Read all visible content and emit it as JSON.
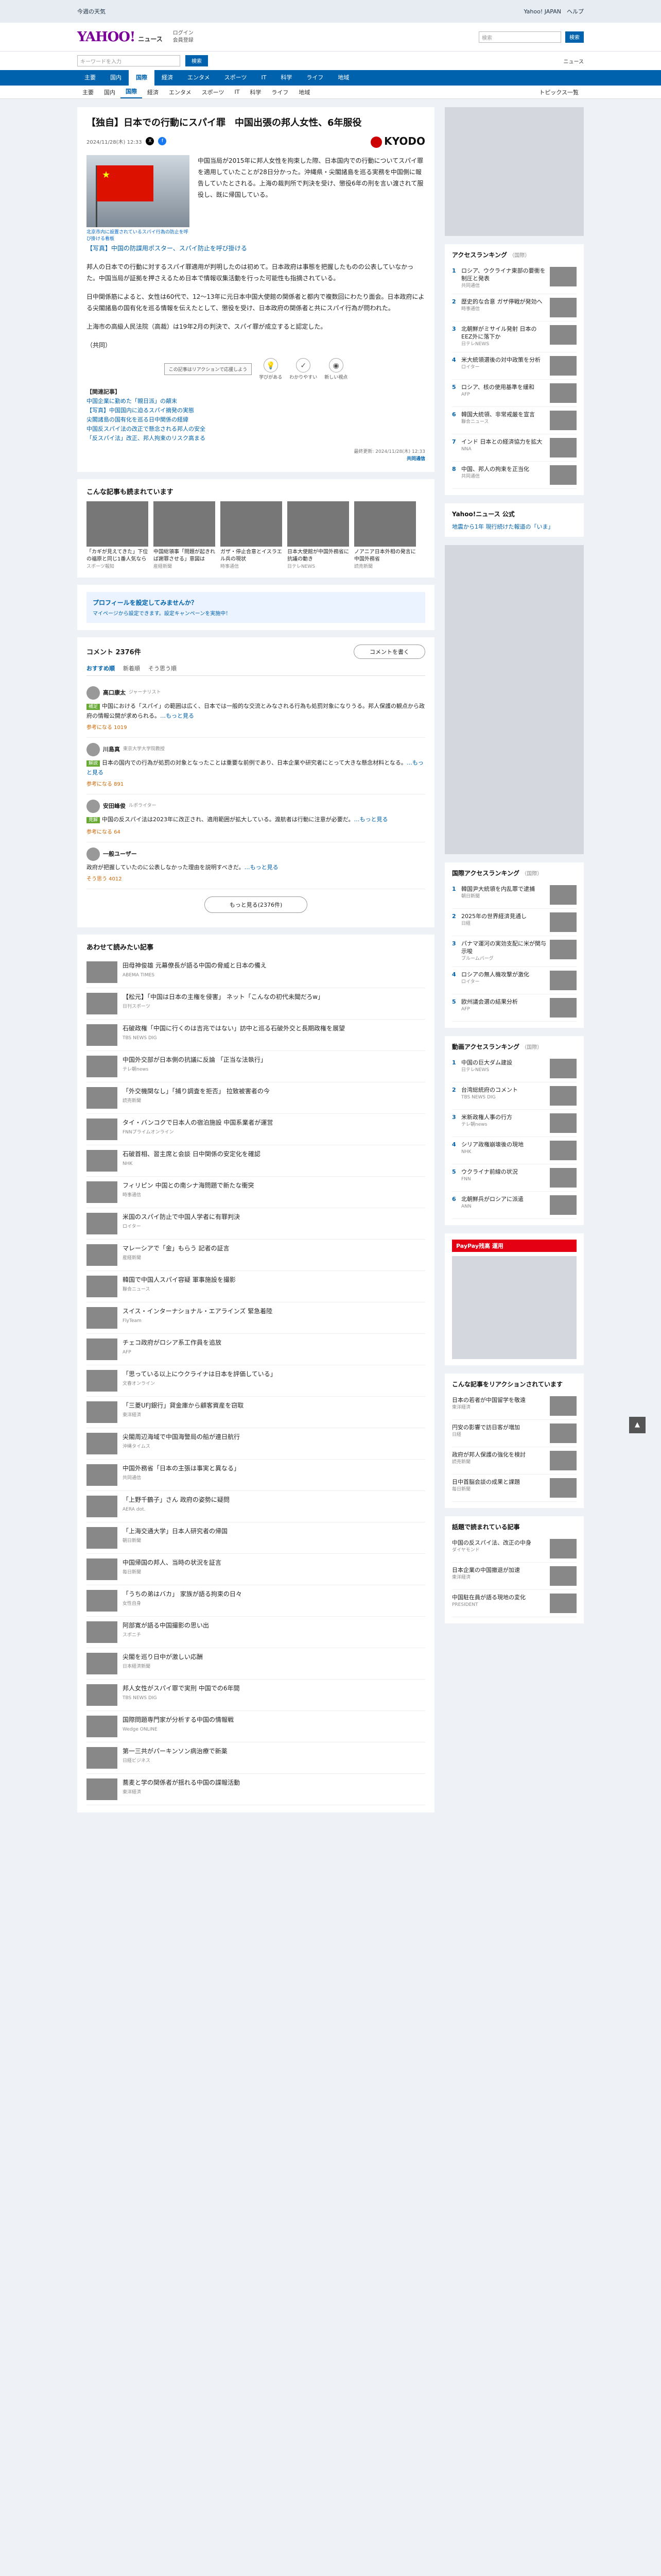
{
  "topbar": {
    "message": "今週の天気",
    "nav": "Yahoo! JAPAN　ヘルプ"
  },
  "header": {
    "logo": "YAHOO!",
    "logo_sub": "ニュース",
    "link1": "ログイン",
    "link2": "会員登録",
    "search_placeholder": "検索",
    "search_button": "検索"
  },
  "search": {
    "placeholder": "キーワードを入力",
    "button": "検索",
    "right": "ニュース"
  },
  "catnav": [
    "主要",
    "国内",
    "国際",
    "経済",
    "エンタメ",
    "スポーツ",
    "IT",
    "科学",
    "ライフ",
    "地域"
  ],
  "catnav_active": "国際",
  "subnav": [
    "主要",
    "国内",
    "国際",
    "経済",
    "エンタメ",
    "スポーツ",
    "IT",
    "科学",
    "ライフ",
    "地域"
  ],
  "subnav_more": "トピックス一覧",
  "article": {
    "title": "【独自】日本での行動にスパイ罪　中国出張の邦人女性、6年服役",
    "date": "2024/11/28(木) 12:33",
    "source": "KYODO",
    "photo_caption": "北京市内に設置されているスパイ行為の防止を呼び掛ける看板",
    "paragraphs": [
      "中国当局が2015年に邦人女性を拘束した際、日本国内での行動についてスパイ罪を適用していたことが28日分かった。沖縄県・尖閣諸島を巡る実務を中国側に報告していたとされる。上海の裁判所で判決を受け、懲役6年の刑を言い渡されて服役し、既に帰国している。",
      "邦人の日本での行動に対するスパイ罪適用が判明したのは初めて。日本政府は事態を把握したものの公表していなかった。中国当局が証拠を押さえるため日本で情報収集活動を行った可能性も指摘されている。",
      "日中関係筋によると、女性は60代で、12〜13年に元日本中国大使館の関係者と都内で複数回にわたり面会。日本政府による尖閣諸島の国有化を巡る情報を伝えたとして、懲役を受け、日本政府の関係者と共にスパイ行為が問われた。",
      "上海市の高級人民法院（高裁）は19年2月の判決で、スパイ罪が成立すると認定した。"
    ],
    "paragraph_credit": "（共同）",
    "photo_headline": "【写真】中国の防諜用ポスター、スパイ防止を呼び掛ける",
    "tooltip": "この記事はリアクションで応援しよう",
    "reactions": [
      "学びがある",
      "わかりやすい",
      "新しい視点"
    ],
    "related_label": "【関連記事】",
    "related": [
      "中国企業に勤めた「親日派」の顛末",
      "【写真】中国国内に迫るスパイ摘発の実態",
      "尖閣諸島の国有化を巡る日中関係の経緯",
      "中国反スパイ法の改正で懸念される邦人の安全",
      "「反スパイ法」改正、邦人拘束のリスク高まる"
    ],
    "endnote": "最終更新: 2024/11/28(木) 12:33",
    "endnote_link": "共同通信"
  },
  "recommended": {
    "title": "こんな記事も読まれています",
    "items": [
      {
        "title": "「カギが見えてきた」下位の福原と同じ1番人気なら",
        "src": "スポーツ報知"
      },
      {
        "title": "中国総領事「問題が起きれば謝罪させる」意図は",
        "src": "産経新聞"
      },
      {
        "title": "ガザ・停止合意とイスラエル兵の現状",
        "src": "時事通信"
      },
      {
        "title": "日本大使館が中国外務省に抗議の動き",
        "src": "日テレNEWS"
      },
      {
        "title": "ノアニア日本外相の発言に中国外務省",
        "src": "読売新聞"
      }
    ]
  },
  "promo": {
    "title": "プロフィールを設定してみませんか？",
    "sub": "マイページから設定できます。設定キャンペーンを実施中！"
  },
  "comments": {
    "count": "コメント 2376件",
    "write": "コメントを書く",
    "tabs": [
      "おすすめ順",
      "新着順",
      "そう思う順"
    ],
    "items": [
      {
        "name": "高口康太",
        "role": "ジャーナリスト",
        "tag": "補足",
        "text": "中国における「スパイ」の範囲は広く、日本では一般的な交流とみなされる行為も処罰対象になりうる。邦人保護の観点から政府の情報公開が求められる。",
        "more": "…もっと見る",
        "likes": "参考になる 1019"
      },
      {
        "name": "川島真",
        "role": "東京大学大学院教授",
        "tag": "解説",
        "text": "日本の国内での行為が処罰の対象となったことは重要な前例であり、日本企業や研究者にとって大きな懸念材料となる。",
        "more": "…もっと見る",
        "likes": "参考になる 891"
      },
      {
        "name": "安田峰俊",
        "role": "ルポライター",
        "tag": "見解",
        "text": "中国の反スパイ法は2023年に改正され、適用範囲が拡大している。渡航者は行動に注意が必要だ。",
        "more": "…もっと見る",
        "likes": "参考になる 64"
      },
      {
        "name": "一般ユーザー",
        "role": "",
        "tag": "",
        "text": "政府が把握していたのに公表しなかった理由を説明すべきだ。",
        "more": "…もっと見る",
        "likes": "そう思う 4012"
      }
    ],
    "more_button": "もっと見る(2376件)"
  },
  "nextread": {
    "title": "あわせて読みたい記事",
    "items": [
      {
        "t": "田母神俊雄 元幕僚長が語る中国の脅威と日本の備え",
        "s": "ABEMA TIMES"
      },
      {
        "t": "【松元】「中国は日本の主権を侵害」 ネット「こんなの初代未聞だろw」",
        "s": "日刊スポーツ"
      },
      {
        "t": "石破政権「中国に行くのは吉兆ではない」訪中と巡る石破外交と長期政権を展望",
        "s": "TBS NEWS DIG"
      },
      {
        "t": "中国外交部が日本側の抗議に反論 「正当な法執行」",
        "s": "テレ朝news"
      },
      {
        "t": "「外交機関なし」「捕り調査を拒否」 拉致被害者の今",
        "s": "読売新聞"
      },
      {
        "t": "タイ・バンコクで日本人の宿泊施設 中国系業者が運営",
        "s": "FNNプライムオンライン"
      },
      {
        "t": "石破首相、習主席と会談 日中関係の安定化を確認",
        "s": "NHK"
      },
      {
        "t": "フィリピン 中国との南シナ海問題で新たな衝突",
        "s": "時事通信"
      },
      {
        "t": "米国のスパイ防止で中国人学者に有罪判決",
        "s": "ロイター"
      },
      {
        "t": "マレーシアで「金」もらう 記者の証言",
        "s": "産経新聞"
      },
      {
        "t": "韓国で中国人スパイ容疑 軍事施設を撮影",
        "s": "聯合ニュース"
      },
      {
        "t": "スイス・インターナショナル・エアラインズ 緊急着陸",
        "s": "FlyTeam"
      },
      {
        "t": "チェコ政府がロシア系工作員を追放",
        "s": "AFP"
      },
      {
        "t": "「思っている以上にウクライナは日本を評価している」",
        "s": "文春オンライン"
      },
      {
        "t": "「三菱UFJ銀行」貸金庫から顧客資産を窃取",
        "s": "東洋経済"
      },
      {
        "t": "尖閣周辺海域で中国海警局の船が連日航行",
        "s": "沖縄タイムス"
      },
      {
        "t": "中国外務省「日本の主張は事実と異なる」",
        "s": "共同通信"
      },
      {
        "t": "「上野千鶴子」さん 政府の姿勢に疑問",
        "s": "AERA dot."
      },
      {
        "t": "「上海交通大学」日本人研究者の帰国",
        "s": "朝日新聞"
      },
      {
        "t": "中国帰国の邦人、当時の状況を証言",
        "s": "毎日新聞"
      },
      {
        "t": "「うちの弟はバカ」 家族が語る拘束の日々",
        "s": "女性自身"
      },
      {
        "t": "阿部寛が語る中国撮影の思い出",
        "s": "スポニチ"
      },
      {
        "t": "尖閣を巡り日中が激しい応酬",
        "s": "日本経済新聞"
      },
      {
        "t": "邦人女性がスパイ罪で実刑 中国での6年間",
        "s": "TBS NEWS DIG"
      },
      {
        "t": "国際問題専門家が分析する中国の情報戦",
        "s": "Wedge ONLINE"
      },
      {
        "t": "第一三共がパーキンソン病治療で新薬",
        "s": "日経ビジネス"
      },
      {
        "t": "蕎麦と学の関係者が揺れる中国の諜報活動",
        "s": "東洋経済"
      }
    ]
  },
  "side": {
    "access_title": "アクセスランキング",
    "access_sub": "（国際）",
    "access": [
      {
        "t": "ロシア、ウクライナ東部の要衝を制圧と発表",
        "s": "共同通信"
      },
      {
        "t": "歴史的な合意 ガザ停戦が発効へ",
        "s": "時事通信"
      },
      {
        "t": "北朝鮮がミサイル発射 日本のEEZ外に落下か",
        "s": "日テレNEWS"
      },
      {
        "t": "米大統領選後の対中政策を分析",
        "s": "ロイター"
      },
      {
        "t": "ロシア、核の使用基準を緩和",
        "s": "AFP"
      },
      {
        "t": "韓国大統領、非常戒厳を宣言",
        "s": "聯合ニュース"
      },
      {
        "t": "インド 日本との経済協力を拡大",
        "s": "NNA"
      },
      {
        "t": "中国、邦人の拘束を正当化",
        "s": "共同通信"
      }
    ],
    "yahoo_label": "Yahoo!ニュース 公式",
    "yahoo_text": "地震から1年 現行続けた報道の「いま」",
    "ranking2_title": "国際アクセスランキング",
    "ranking2_sub": "（国際）",
    "ranking2": [
      {
        "t": "韓国尹大統領を内乱罪で逮捕",
        "s": "朝日新聞"
      },
      {
        "t": "2025年の世界経済見通し",
        "s": "日経"
      },
      {
        "t": "パナマ運河の実効支配に米が関与示唆",
        "s": "ブルームバーグ"
      },
      {
        "t": "ロシアの無人機攻撃が激化",
        "s": "ロイター"
      },
      {
        "t": "欧州議会選の結果分析",
        "s": "AFP"
      }
    ],
    "ranking3_title": "動画アクセスランキング",
    "ranking3_sub": "（国際）",
    "ranking3": [
      {
        "t": "中国の巨大ダム建設",
        "s": "日テレNEWS"
      },
      {
        "t": "台湾総統府のコメント",
        "s": "TBS NEWS DIG"
      },
      {
        "t": "米新政権人事の行方",
        "s": "テレ朝news"
      },
      {
        "t": "シリア政権崩壊後の現地",
        "s": "NHK"
      },
      {
        "t": "ウクライナ前線の状況",
        "s": "FNN"
      },
      {
        "t": "北朝鮮兵がロシアに派遣",
        "s": "ANN"
      }
    ],
    "ppay": "PayPay残高 運用",
    "topics_title": "こんな記事をリアクションされています",
    "topics": [
      {
        "t": "日本の若者が中国留学を敬遠",
        "s": "東洋経済"
      },
      {
        "t": "円安の影響で訪日客が増加",
        "s": "日経"
      },
      {
        "t": "政府が邦人保護の強化を検討",
        "s": "読売新聞"
      },
      {
        "t": "日中首脳会談の成果と課題",
        "s": "毎日新聞"
      }
    ],
    "topics2_title": "話題で読まれている記事",
    "topics2": [
      {
        "t": "中国の反スパイ法、改正の中身",
        "s": "ダイヤモンド"
      },
      {
        "t": "日本企業の中国撤退が加速",
        "s": "東洋経済"
      },
      {
        "t": "中国駐在員が語る現地の変化",
        "s": "PRESIDENT"
      }
    ]
  },
  "colors": {
    "brand": "#7b0099",
    "accent": "#0062ad"
  }
}
